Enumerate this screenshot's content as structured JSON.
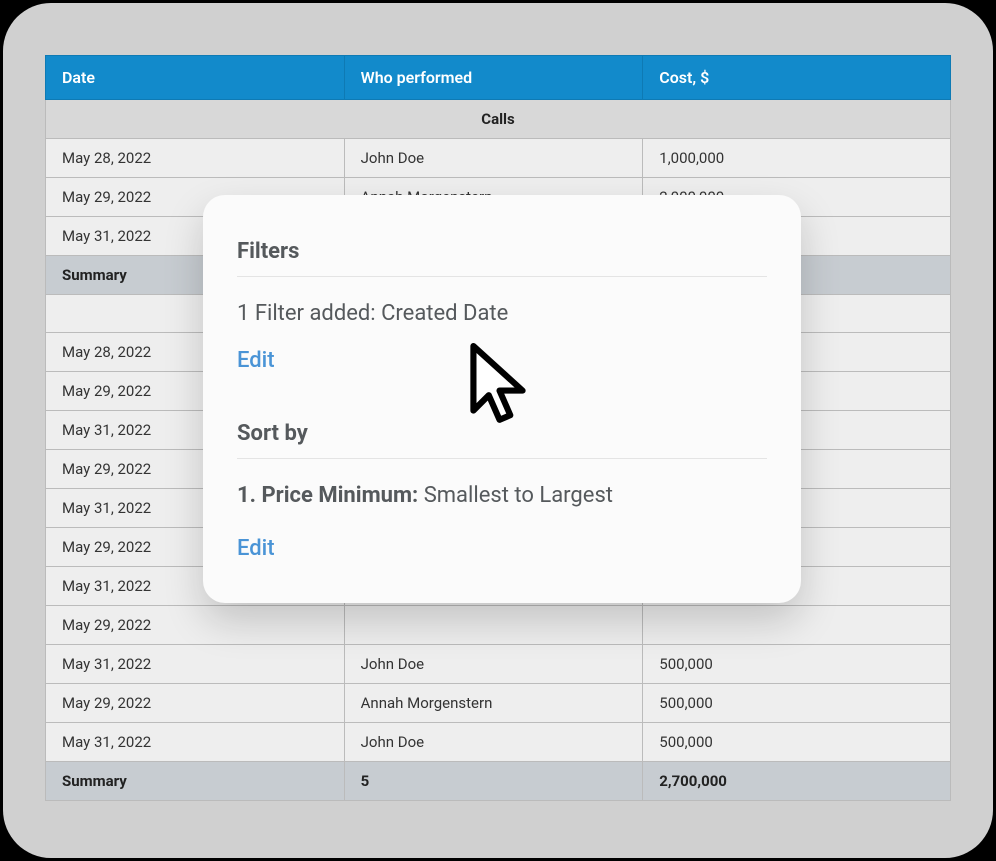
{
  "table": {
    "headers": [
      "Date",
      "Who performed",
      "Cost, $"
    ],
    "section_label": "Calls",
    "rows_top": [
      {
        "date": "May 28, 2022",
        "who": "John Doe",
        "cost": "1,000,000"
      },
      {
        "date": "May 29, 2022",
        "who": "Annah Morgenstern",
        "cost": "2,000,000"
      },
      {
        "date": "May 31, 2022",
        "who": "",
        "cost": ""
      }
    ],
    "summary_top": {
      "label": "Summary",
      "count": "",
      "total": ""
    },
    "rows_bottom": [
      {
        "date": "May 28, 2022",
        "who": "",
        "cost": ""
      },
      {
        "date": "May 29, 2022",
        "who": "",
        "cost": ""
      },
      {
        "date": "May 31, 2022",
        "who": "",
        "cost": ""
      },
      {
        "date": "May 29, 2022",
        "who": "",
        "cost": ""
      },
      {
        "date": "May 31, 2022",
        "who": "",
        "cost": ""
      },
      {
        "date": "May 29, 2022",
        "who": "",
        "cost": ""
      },
      {
        "date": "May 31, 2022",
        "who": "",
        "cost": ""
      },
      {
        "date": "May 29, 2022",
        "who": "",
        "cost": ""
      },
      {
        "date": "May 31, 2022",
        "who": "John Doe",
        "cost": "500,000"
      },
      {
        "date": "May 29, 2022",
        "who": "Annah Morgenstern",
        "cost": "500,000"
      },
      {
        "date": "May 31, 2022",
        "who": "John Doe",
        "cost": "500,000"
      }
    ],
    "summary_bottom": {
      "label": "Summary",
      "count": "5",
      "total": "2,700,000"
    }
  },
  "popover": {
    "filters_heading": "Filters",
    "filter_summary": "1 Filter added: Created Date",
    "edit_label": "Edit",
    "sort_heading": "Sort by",
    "sort_rule_label": "1. Price Minimum:",
    "sort_rule_order": "Smallest to Largest",
    "sort_edit_label": "Edit"
  }
}
